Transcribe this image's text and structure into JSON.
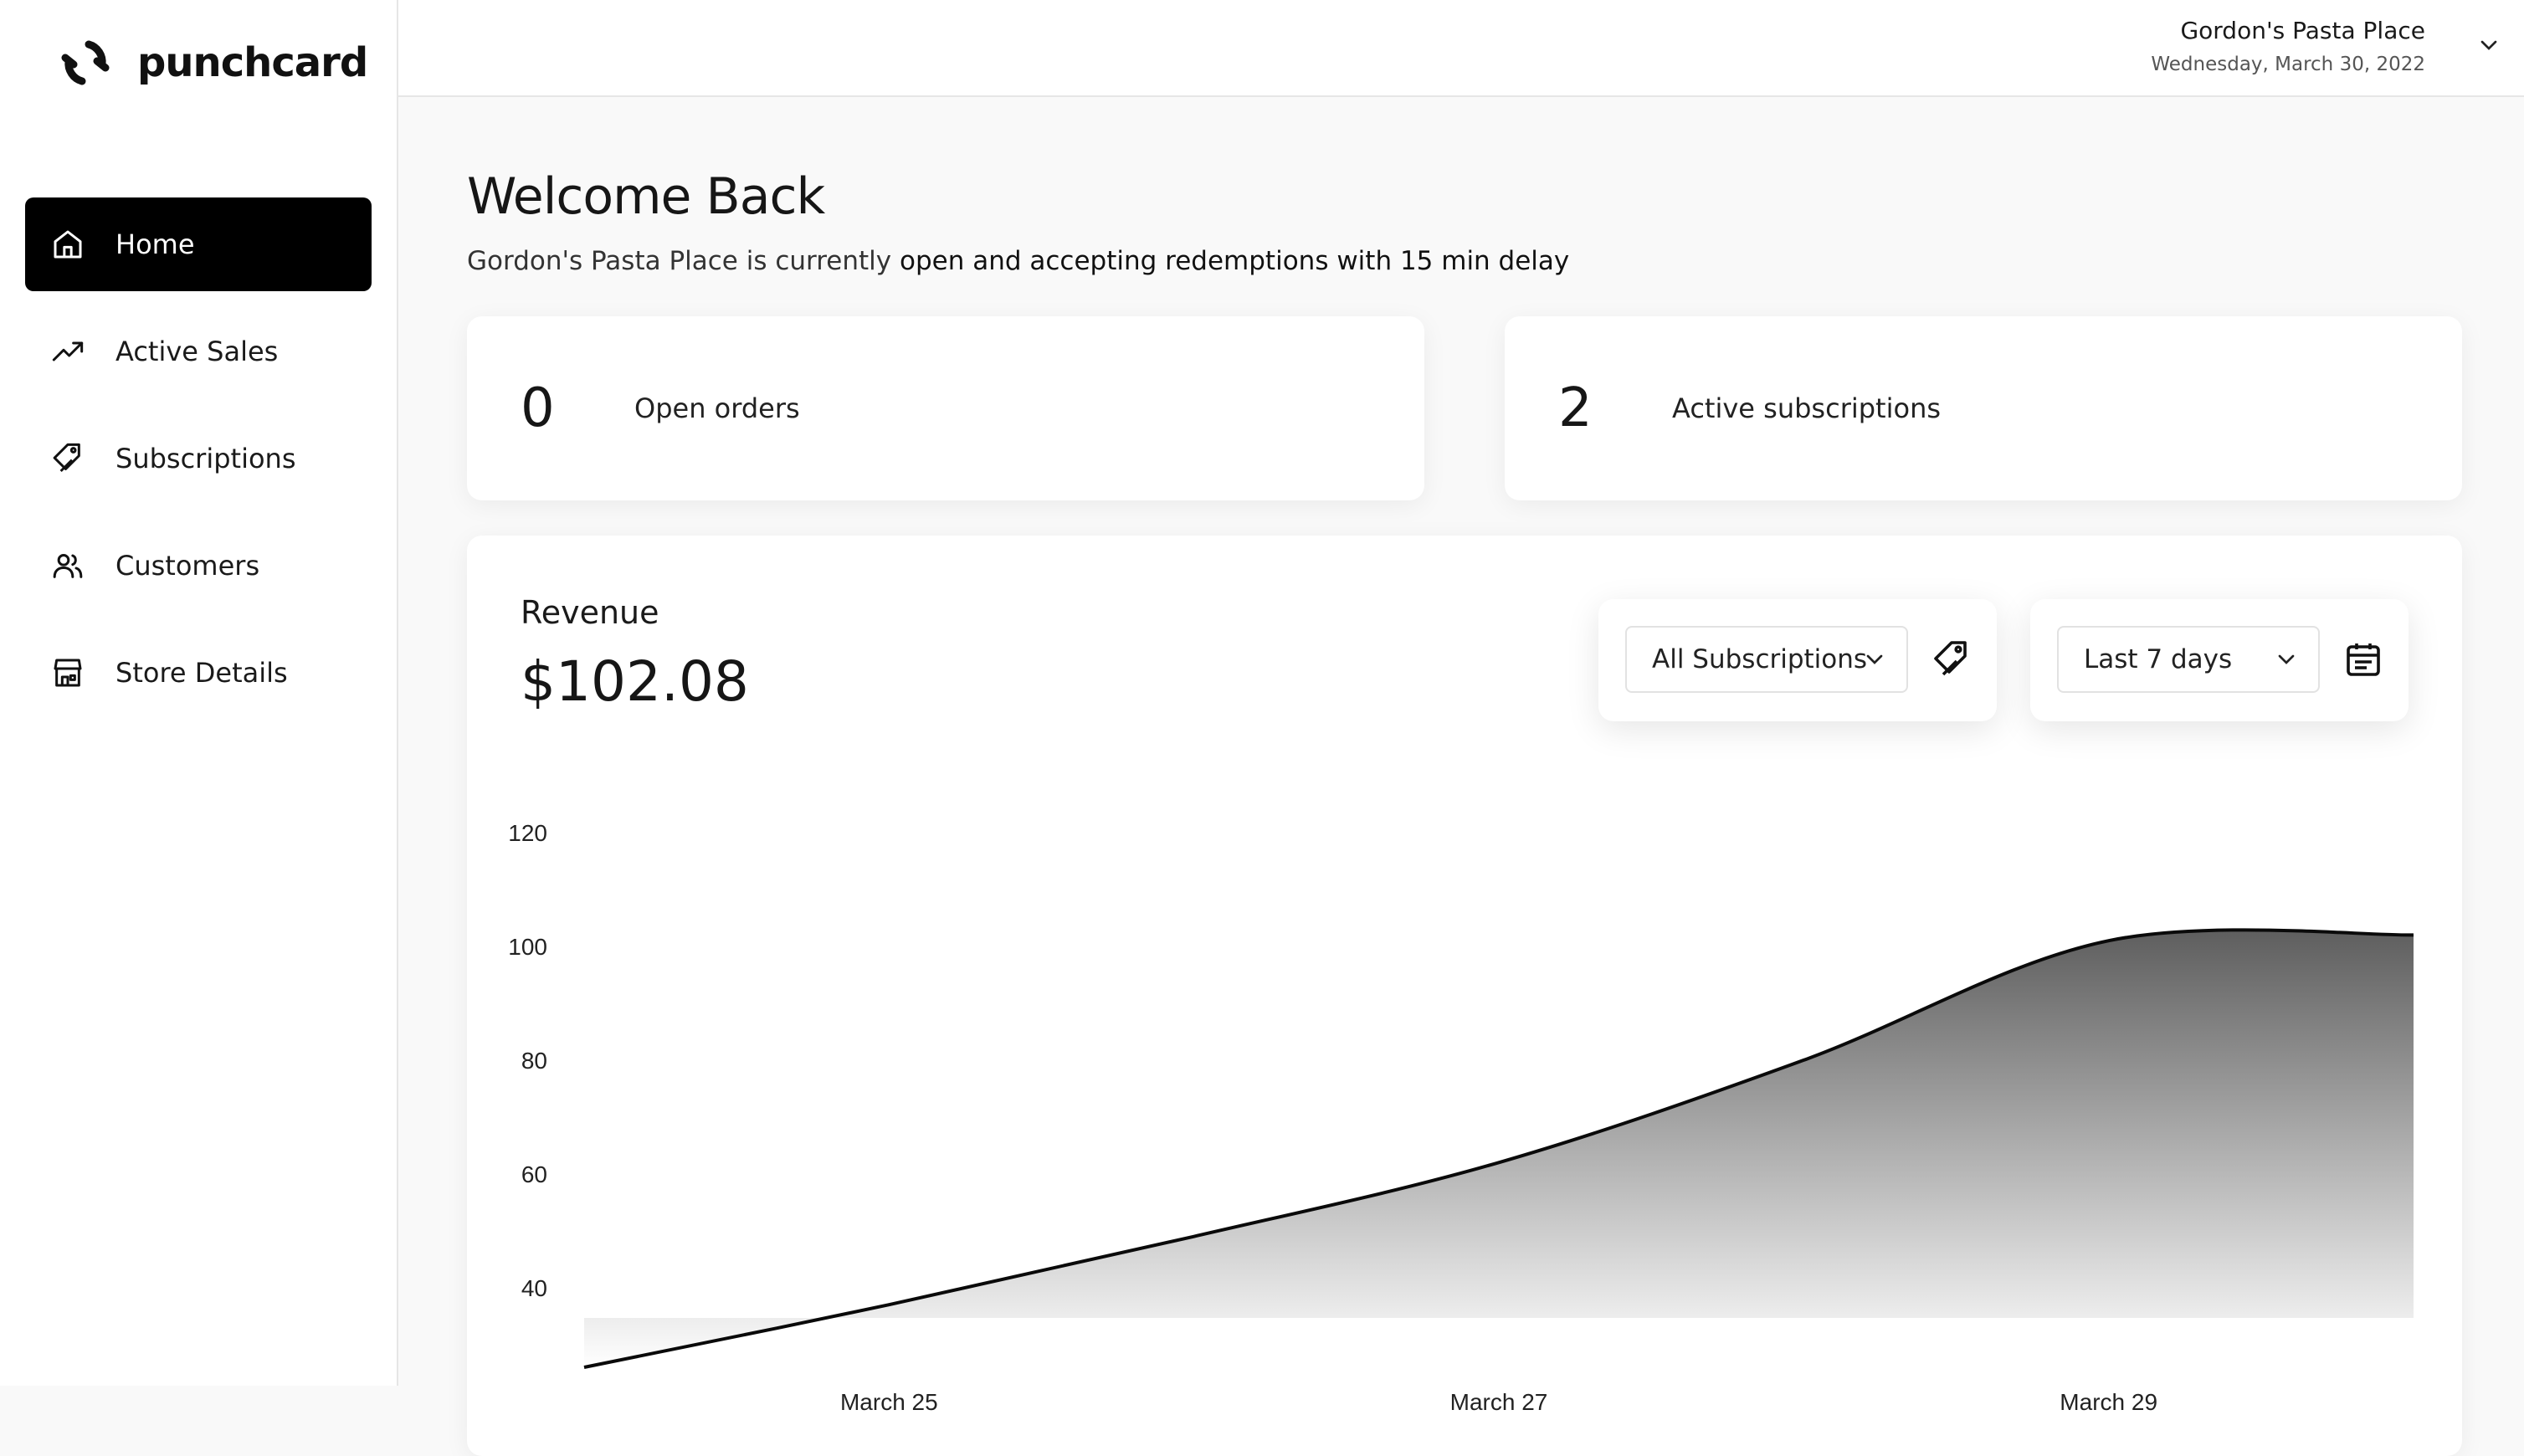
{
  "app": {
    "name": "punchcard"
  },
  "sidebar": {
    "items": [
      {
        "label": "Home",
        "icon": "home-icon",
        "active": true
      },
      {
        "label": "Active Sales",
        "icon": "trending-up-icon",
        "active": false
      },
      {
        "label": "Subscriptions",
        "icon": "tag-icon",
        "active": false
      },
      {
        "label": "Customers",
        "icon": "users-icon",
        "active": false
      },
      {
        "label": "Store Details",
        "icon": "store-icon",
        "active": false
      }
    ]
  },
  "header": {
    "store_name": "Gordon's Pasta Place",
    "date": "Wednesday, March 30, 2022"
  },
  "main": {
    "welcome": "Welcome Back",
    "status_prefix": "Gordon's Pasta Place is currently",
    "status_highlight": "open and accepting redemptions with 15 min delay",
    "stats": [
      {
        "value": "0",
        "label": "Open orders"
      },
      {
        "value": "2",
        "label": "Active subscriptions"
      }
    ],
    "revenue": {
      "title": "Revenue",
      "amount": "$102.08",
      "subscription_filter": "All Subscriptions",
      "date_filter": "Last 7 days"
    }
  },
  "colors": {
    "accent": "#000000",
    "background": "#f9f9f9",
    "card": "#ffffff"
  },
  "chart_data": {
    "type": "area",
    "title": "",
    "x": [
      "March 24",
      "March 25",
      "March 26",
      "March 27",
      "March 28",
      "March 29",
      "March 30"
    ],
    "x_tick_labels": [
      "March 25",
      "March 27",
      "March 29"
    ],
    "values": [
      26,
      37,
      49,
      62,
      80,
      101,
      102
    ],
    "yticks": [
      40,
      60,
      80,
      100,
      120
    ],
    "ylim": [
      26,
      120
    ],
    "xlabel": "",
    "ylabel": "",
    "grid": false,
    "legend": "none"
  }
}
